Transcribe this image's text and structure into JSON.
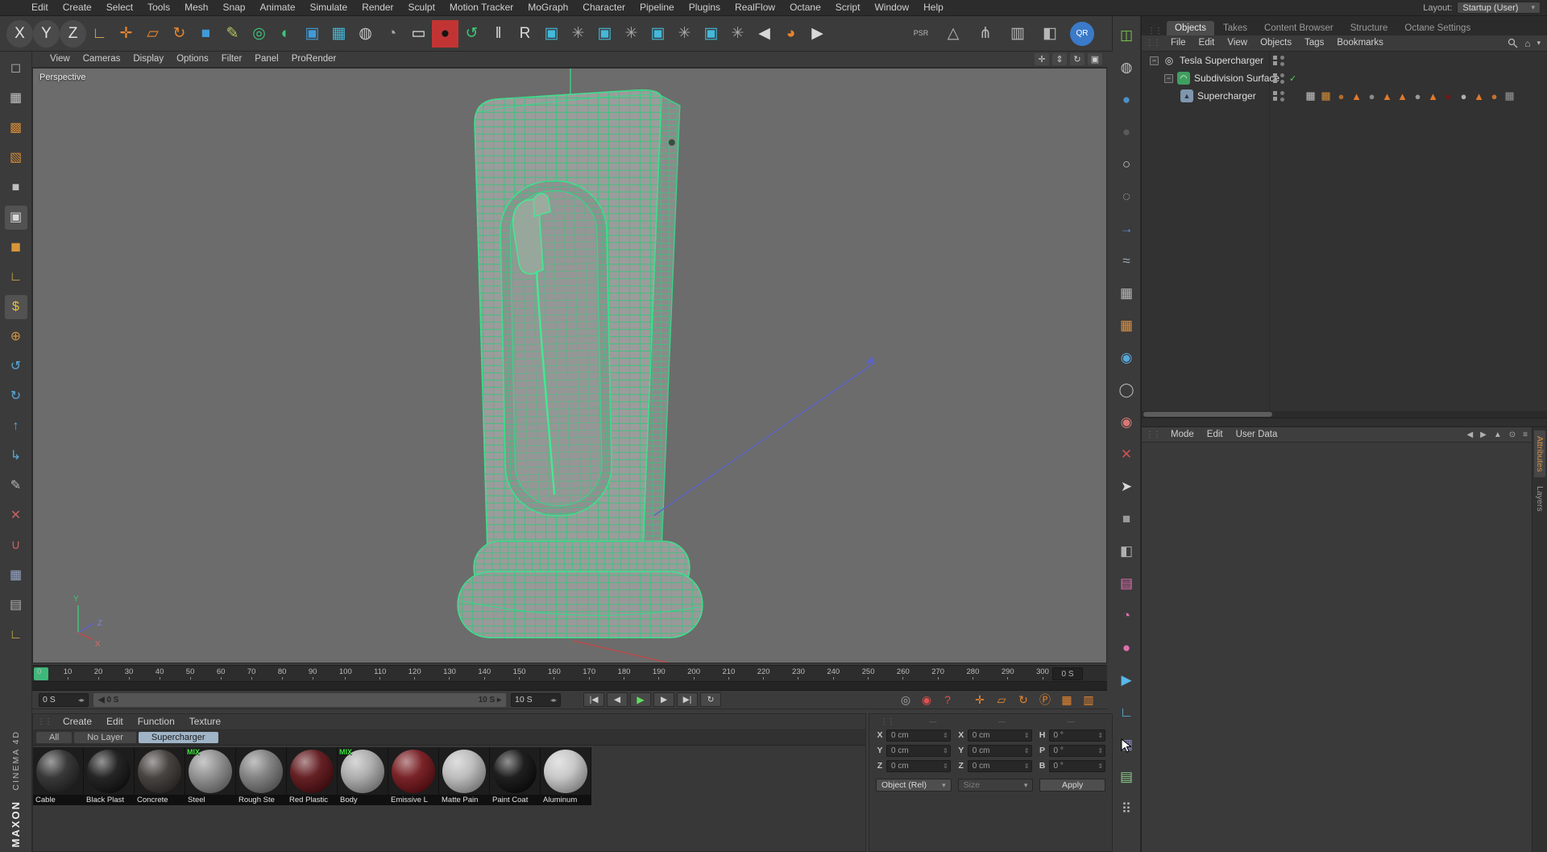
{
  "menu_bar": {
    "items": [
      "Edit",
      "Create",
      "Select",
      "Tools",
      "Mesh",
      "Snap",
      "Animate",
      "Simulate",
      "Render",
      "Sculpt",
      "Motion Tracker",
      "MoGraph",
      "Character",
      "Pipeline",
      "Plugins",
      "RealFlow",
      "Octane",
      "Script",
      "Window",
      "Help"
    ],
    "layout_label": "Layout:",
    "layout_value": "Startup (User)"
  },
  "toolbar": {
    "icons_left": [
      {
        "name": "x-axis-lock-icon",
        "glyph": "X",
        "color": "#e0e0e0",
        "bg": "#4a4a4a",
        "round": "50%"
      },
      {
        "name": "y-axis-lock-icon",
        "glyph": "Y",
        "color": "#e0e0e0",
        "bg": "#4a4a4a",
        "round": "50%"
      },
      {
        "name": "z-axis-lock-icon",
        "glyph": "Z",
        "color": "#e0e0e0",
        "bg": "#4a4a4a",
        "round": "50%"
      },
      {
        "name": "workplane-icon",
        "glyph": "∟",
        "color": "#d8b050"
      },
      {
        "name": "move-tool-icon",
        "glyph": "✛",
        "color": "#e8862e"
      },
      {
        "name": "scale-tool-icon",
        "glyph": "▱",
        "color": "#e8862e"
      },
      {
        "name": "rotate-tool-icon",
        "glyph": "↻",
        "color": "#e8862e"
      },
      {
        "name": "add-cube-icon",
        "glyph": "■",
        "color": "#3f9bd8"
      },
      {
        "name": "spline-pen-icon",
        "glyph": "✎",
        "color": "#b8c860"
      },
      {
        "name": "cloner-icon",
        "glyph": "◎",
        "color": "#3cc87a"
      },
      {
        "name": "sphere-primitive-icon",
        "glyph": "◐",
        "color": "#3cc87a"
      },
      {
        "name": "cube-array-icon",
        "glyph": "▣",
        "color": "#3f9bd8"
      },
      {
        "name": "grid-array-icon",
        "glyph": "▦",
        "color": "#45b8d8"
      },
      {
        "name": "render-view-icon",
        "glyph": "◍",
        "color": "#c8c8c8"
      },
      {
        "name": "render-region-icon",
        "glyph": "◔",
        "color": "#a8a8a8"
      },
      {
        "name": "interactive-render-icon",
        "glyph": "▭",
        "color": "#e8e8e8"
      },
      {
        "name": "render-settings-icon",
        "glyph": "●",
        "color": "#141414",
        "bg": "#c23434"
      },
      {
        "name": "octane-render-icon",
        "glyph": "↺",
        "color": "#3cc87a"
      },
      {
        "name": "pause-icon",
        "glyph": "‖",
        "color": "#d8d8d8"
      },
      {
        "name": "realflow-icon",
        "glyph": "R",
        "color": "#d8d8d8"
      },
      {
        "name": "scene-object-icon",
        "glyph": "▣",
        "color": "#45b8d8"
      },
      {
        "name": "scene-gear-icon",
        "glyph": "✳",
        "color": "#a8a8a8"
      },
      {
        "name": "simulation-object-icon",
        "glyph": "▣",
        "color": "#45b8d8"
      },
      {
        "name": "simulation-gear-icon",
        "glyph": "✳",
        "color": "#a8a8a8"
      },
      {
        "name": "dynamics-object-icon",
        "glyph": "▣",
        "color": "#45b8d8"
      },
      {
        "name": "dynamics-gear-icon",
        "glyph": "✳",
        "color": "#a8a8a8"
      },
      {
        "name": "field-object-icon",
        "glyph": "▣",
        "color": "#45b8d8"
      },
      {
        "name": "field-gear-icon",
        "glyph": "✳",
        "color": "#a8a8a8"
      },
      {
        "name": "previous-layout-icon",
        "glyph": "◀",
        "color": "#d8d8d8"
      },
      {
        "name": "cinema4d-icon",
        "glyph": "◕",
        "color": "#e8862e"
      },
      {
        "name": "next-layout-icon",
        "glyph": "▶",
        "color": "#d8d8d8"
      }
    ],
    "icons_right": [
      {
        "name": "psr-lock-icon",
        "glyph": "PSR",
        "color": "#b8b8b8",
        "size": "9px"
      },
      {
        "name": "ik-triangle-icon",
        "glyph": "△",
        "color": "#b8b8b8"
      },
      {
        "name": "joint-tool-icon",
        "glyph": "⋔",
        "color": "#b8b8b8"
      },
      {
        "name": "weight-panel-icon",
        "glyph": "▥",
        "color": "#b8b8b8"
      },
      {
        "name": "mirror-tool-icon",
        "glyph": "◧",
        "color": "#b8b8b8"
      },
      {
        "name": "qr-helper-icon",
        "glyph": "QR",
        "color": "#ffffff",
        "bg": "#3a7ac8",
        "round": "50%",
        "size": "10px"
      }
    ]
  },
  "left_palette": {
    "icons": [
      {
        "name": "selection-frame-icon",
        "glyph": "◻",
        "color": "#b0b0b0"
      },
      {
        "name": "texture-checker-icon",
        "glyph": "▦",
        "color": "#c4c4c4"
      },
      {
        "name": "uv-points-icon",
        "glyph": "▩",
        "color": "#d08a3a"
      },
      {
        "name": "uv-polygons-icon",
        "glyph": "▧",
        "color": "#d08a3a"
      },
      {
        "name": "model-mode-icon",
        "glyph": "■",
        "color": "#c0c0c0"
      },
      {
        "name": "object-mode-icon",
        "glyph": "▣",
        "color": "#d8d8d8",
        "bg": "#525252"
      },
      {
        "name": "polygon-cube-icon",
        "glyph": "◼",
        "color": "#d8963a"
      },
      {
        "name": "workplane-mode-icon",
        "glyph": "∟",
        "color": "#d8b050"
      },
      {
        "name": "simulation-mode-icon",
        "glyph": "$",
        "color": "#e8c23c",
        "bg": "#525252"
      },
      {
        "name": "axis-mode-icon",
        "glyph": "⊕",
        "color": "#d8963a"
      },
      {
        "name": "soft-selection-icon",
        "glyph": "↺",
        "color": "#58a8d8"
      },
      {
        "name": "tweak-mode-icon",
        "glyph": "↻",
        "color": "#58a8d8"
      },
      {
        "name": "normal-move-icon",
        "glyph": "↑",
        "color": "#58a8d8"
      },
      {
        "name": "normal-rotate-icon",
        "glyph": "↳",
        "color": "#58a8d8"
      },
      {
        "name": "knife-tool-icon",
        "glyph": "✎",
        "color": "#b8b8b8"
      },
      {
        "name": "delete-tool-icon",
        "glyph": "✕",
        "color": "#c86060"
      },
      {
        "name": "magnet-tool-icon",
        "glyph": "∪",
        "color": "#c86060"
      },
      {
        "name": "brush-grid-icon",
        "glyph": "▦",
        "color": "#98a8c8"
      },
      {
        "name": "notes-icon",
        "glyph": "▤",
        "color": "#b0b0b0"
      },
      {
        "name": "snap-corner-icon",
        "glyph": "∟",
        "color": "#d8b050"
      }
    ]
  },
  "viewport": {
    "menu": [
      "View",
      "Cameras",
      "Display",
      "Options",
      "Filter",
      "Panel",
      "ProRender"
    ],
    "camera_label": "Perspective",
    "axis_labels": {
      "x": "X",
      "y": "Y",
      "z": "Z"
    }
  },
  "timeline": {
    "ticks": [
      "0",
      "10",
      "20",
      "30",
      "40",
      "50",
      "60",
      "70",
      "80",
      "90",
      "100",
      "110",
      "120",
      "130",
      "140",
      "150",
      "160",
      "170",
      "180",
      "190",
      "200",
      "210",
      "220",
      "230",
      "240",
      "250",
      "260",
      "270",
      "280",
      "290",
      "300"
    ],
    "unit_box": "0 S"
  },
  "playback": {
    "current_field": "0 S",
    "range_start": "0 S",
    "range_end": "10 S",
    "end_field": "10 S"
  },
  "materials": {
    "menu": [
      "Create",
      "Edit",
      "Function",
      "Texture"
    ],
    "layer_tabs": [
      "All",
      "No Layer",
      "Supercharger"
    ],
    "active_tab": "Supercharger",
    "items": [
      {
        "name": "Cable",
        "color": "#2a2a2a"
      },
      {
        "name": "Black Plast",
        "color": "#151515"
      },
      {
        "name": "Concrete",
        "color": "#3a3632"
      },
      {
        "name": "Steel",
        "color": "#8a8a8a",
        "badge": "MIX"
      },
      {
        "name": "Rough Ste",
        "color": "#7a7a7a"
      },
      {
        "name": "Red Plastic",
        "color": "#5a1014"
      },
      {
        "name": "Body",
        "color": "#a8a8a8",
        "badge": "MIX"
      },
      {
        "name": "Emissive L",
        "color": "#701318"
      },
      {
        "name": "Matte Pain",
        "color": "#b8b8b8"
      },
      {
        "name": "Paint Coat",
        "color": "#0e0e0e"
      },
      {
        "name": "Aluminum",
        "color": "#c4c4c4"
      }
    ]
  },
  "coordinates": {
    "columns": [
      {
        "rows": [
          {
            "axis": "X",
            "value": "0 cm"
          },
          {
            "axis": "Y",
            "value": "0 cm"
          },
          {
            "axis": "Z",
            "value": "0 cm"
          }
        ]
      },
      {
        "rows": [
          {
            "axis": "X",
            "value": "0 cm"
          },
          {
            "axis": "Y",
            "value": "0 cm"
          },
          {
            "axis": "Z",
            "value": "0 cm"
          }
        ]
      },
      {
        "rows": [
          {
            "axis": "H",
            "value": "0 °"
          },
          {
            "axis": "P",
            "value": "0 °"
          },
          {
            "axis": "B",
            "value": "0 °"
          }
        ]
      }
    ],
    "mode_dropdown": "Object (Rel)",
    "size_dropdown": "Size",
    "apply_label": "Apply"
  },
  "right_rail": {
    "icons": [
      {
        "name": "render-device-icon",
        "glyph": "◫",
        "color": "#7ac94f"
      },
      {
        "name": "shaded-sphere-icon",
        "glyph": "◍",
        "color": "#c0c0c0"
      },
      {
        "name": "blue-sphere-icon",
        "glyph": "●",
        "color": "#4a90c8"
      },
      {
        "name": "dark-sphere-icon",
        "glyph": "●",
        "color": "#5a5a5a"
      },
      {
        "name": "glass-sphere-icon",
        "glyph": "○",
        "color": "#c8c8c8"
      },
      {
        "name": "wire-ball-icon",
        "glyph": "◌",
        "color": "#a8a8a8"
      },
      {
        "name": "path-arrow-icon",
        "glyph": "→",
        "color": "#5a8fd8"
      },
      {
        "name": "spline-wave-icon",
        "glyph": "≈",
        "color": "#9aaabb"
      },
      {
        "name": "checker-tile-icon",
        "glyph": "▦",
        "color": "#b8b8b8"
      },
      {
        "name": "orange-tile-icon",
        "glyph": "▦",
        "color": "#e09040"
      },
      {
        "name": "globe-icon",
        "glyph": "◉",
        "color": "#58a8d8"
      },
      {
        "name": "ring-icon",
        "glyph": "◯",
        "color": "#b8b8b8"
      },
      {
        "name": "red-wire-sphere-icon",
        "glyph": "◉",
        "color": "#d87878"
      },
      {
        "name": "delete-x-icon",
        "glyph": "✕",
        "color": "#d05050"
      },
      {
        "name": "picker-arrow-icon",
        "glyph": "➤",
        "color": "#d8d8d8"
      },
      {
        "name": "gray-cube-icon",
        "glyph": "■",
        "color": "#9a9a9a"
      },
      {
        "name": "shaded-cube-icon",
        "glyph": "◧",
        "color": "#b0b0b0"
      },
      {
        "name": "pink-box-icon",
        "glyph": "▤",
        "color": "#e070b0"
      },
      {
        "name": "pink-disc-icon",
        "glyph": "◔",
        "color": "#e070b0"
      },
      {
        "name": "pink-sphere-icon",
        "glyph": "●",
        "color": "#e070b0"
      },
      {
        "name": "play-scene-icon",
        "glyph": "▶",
        "color": "#58b8e8"
      },
      {
        "name": "corner-tool-icon",
        "glyph": "∟",
        "color": "#58b8e8"
      },
      {
        "name": "grid-a-icon",
        "glyph": "▦",
        "color": "#8a8ac8"
      },
      {
        "name": "grid-b-icon",
        "glyph": "▤",
        "color": "#8ac88a"
      },
      {
        "name": "braille-dots-icon",
        "glyph": "⠿",
        "color": "#b8b8b8"
      }
    ]
  },
  "object_manager": {
    "tabs": [
      "Objects",
      "Takes",
      "Content Browser",
      "Structure",
      "Octane Settings"
    ],
    "active_tab": "Objects",
    "menu": [
      "File",
      "Edit",
      "View",
      "Objects",
      "Tags",
      "Bookmarks"
    ],
    "tree": [
      {
        "name": "Tesla Supercharger"
      },
      {
        "name": "Subdivision Surface"
      },
      {
        "name": "Supercharger"
      }
    ],
    "texture_tags": [
      {
        "glyph": "▦",
        "color": "#c8c8c8"
      },
      {
        "glyph": "▦",
        "color": "#d8903a"
      },
      {
        "glyph": "●",
        "color": "#b06a30"
      },
      {
        "glyph": "▲",
        "color": "#e07a2e"
      },
      {
        "glyph": "●",
        "color": "#8a8a8a"
      },
      {
        "glyph": "▲",
        "color": "#e07a2e"
      },
      {
        "glyph": "▲",
        "color": "#e07a2e"
      },
      {
        "glyph": "●",
        "color": "#9a9a9a"
      },
      {
        "glyph": "▲",
        "color": "#e07a2e"
      },
      {
        "glyph": "●",
        "color": "#7a1518"
      },
      {
        "glyph": "●",
        "color": "#b0b0b0"
      },
      {
        "glyph": "▲",
        "color": "#e07a2e"
      },
      {
        "glyph": "●",
        "color": "#c87030"
      },
      {
        "glyph": "▦",
        "color": "#989898"
      }
    ]
  },
  "attributes_panel": {
    "menu": [
      "Mode",
      "Edit",
      "User Data"
    ],
    "side_tabs": [
      "Attributes",
      "Layers"
    ]
  },
  "branding": {
    "line1": "MAXON",
    "line2": "CINEMA 4D"
  }
}
